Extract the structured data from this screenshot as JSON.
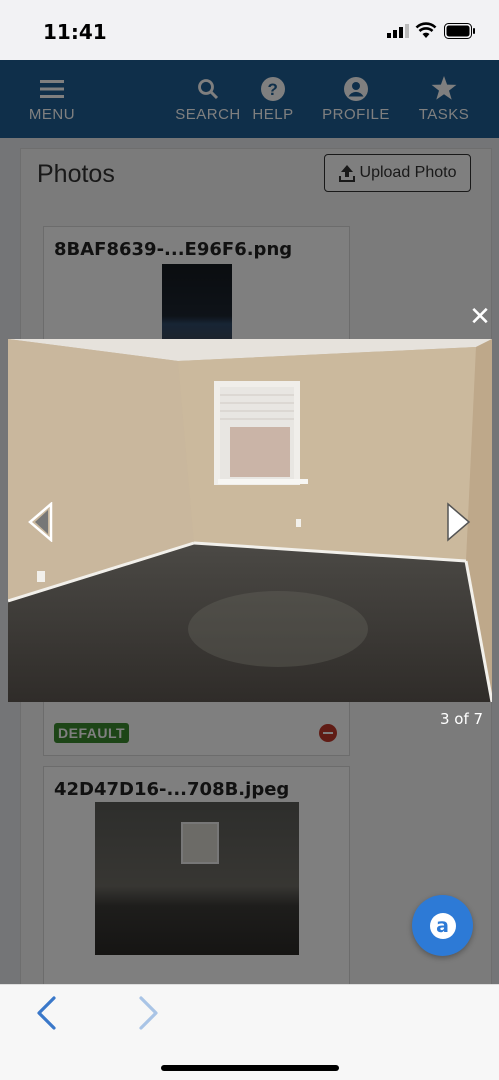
{
  "status_bar": {
    "time": "11:41"
  },
  "navbar": {
    "menu": "MENU",
    "search": "SEARCH",
    "help": "HELP",
    "profile": "PROFILE",
    "tasks": "TASKS"
  },
  "photos": {
    "title": "Photos",
    "upload_label": "Upload Photo",
    "items": [
      {
        "filename": "8BAF8639-...E96F6.png",
        "badge": "DEFAULT"
      },
      {
        "filename": "42D47D16-...708B.jpeg"
      }
    ]
  },
  "lightbox": {
    "counter": "3 of 7",
    "close_symbol": "✕"
  },
  "chat": {
    "symbol": "a"
  },
  "colors": {
    "nav_blue": "#1f5f94",
    "default_green": "#3b8b2f",
    "remove_red": "#c0392b",
    "chat_blue": "#2d7ad6",
    "browser_link_blue": "#3a78c9"
  },
  "icons": {
    "menu": "hamburger-icon",
    "search": "magnifier-icon",
    "help": "question-icon",
    "profile": "user-icon",
    "tasks": "star-icon",
    "upload": "upload-icon",
    "prev": "triangle-left-icon",
    "next": "triangle-right-icon",
    "back": "chevron-left-icon",
    "forward": "chevron-right-icon"
  }
}
